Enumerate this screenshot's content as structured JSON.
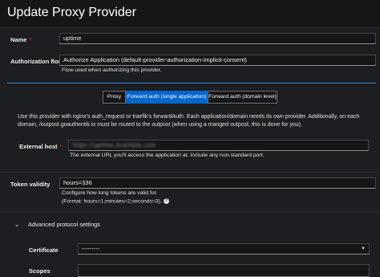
{
  "dialog": {
    "title": "Update Proxy Provider"
  },
  "name": {
    "label": "Name",
    "required_mark": "*",
    "value": "uptime"
  },
  "authorization_flow": {
    "label": "Authorization flow",
    "required_mark": "*",
    "value": "Authorize Application (default-provider-authorization-implicit-consent)",
    "help": "Flow used when authorizing this provider."
  },
  "mode_tabs": [
    {
      "label": "Proxy",
      "active": false
    },
    {
      "label": "Forward auth (single application)",
      "active": true
    },
    {
      "label": "Forward auth (domain level)",
      "active": false
    }
  ],
  "description": "Use this provider with nginx's auth_request or traefik's forwardAuth. Each application/domain needs its own provider. Additionally, on each domain, /outpost.goauthentik.io must be routed to the outpost (when using a manged outpost, this is done for you).",
  "external_host": {
    "label": "External host",
    "required_mark": "*",
    "value": "https://uptime.example.com",
    "help": "The external URL you'll access the application at. Include any non-standard port."
  },
  "token_validity": {
    "label": "Token validity",
    "value": "hours=336",
    "help1": "Configure how long tokens are valid for.",
    "help2": "(Format: hours=1;minutes=2;seconds=3).",
    "help_icon": "question-circle-icon"
  },
  "advanced": {
    "label": "Advanced protocol settings"
  },
  "certificate": {
    "label": "Certificate",
    "value": "---------"
  },
  "scopes": {
    "label": "Scopes"
  }
}
